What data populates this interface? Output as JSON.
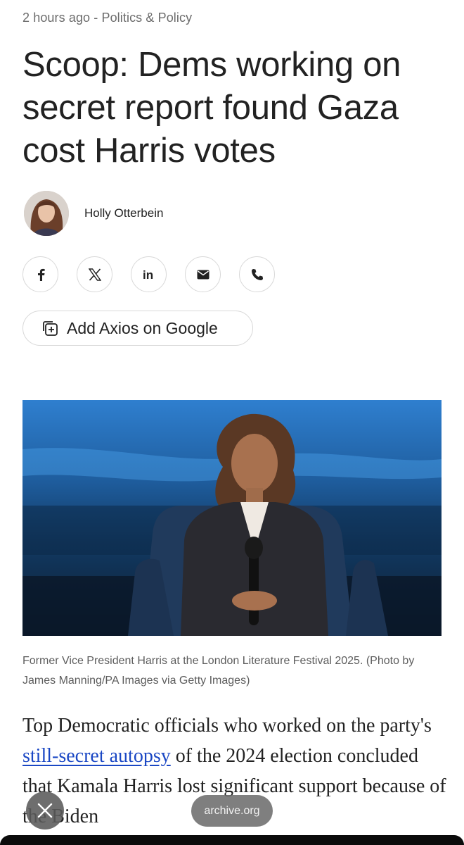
{
  "article": {
    "meta": "2 hours ago - Politics & Policy",
    "headline": "Scoop: Dems working on secret report found Gaza cost Harris votes",
    "author": "Holly Otterbein",
    "add_google_label": "Add Axios on Google",
    "share_icons": [
      "facebook-icon",
      "x-icon",
      "linkedin-icon",
      "email-icon",
      "phone-icon"
    ],
    "photo_caption": "Former Vice President Harris at the London Literature Festival 2025. (Photo by James Manning/PA Images via Getty Images)",
    "body": {
      "before_link": "Top Democratic officials who worked on the party's ",
      "link_text": "still-secret autopsy",
      "after_link": " of the 2024 election concluded that Kamala Harris lost significant support because of the Biden"
    }
  },
  "overlay": {
    "archive_label": "archive.org",
    "close_icon": "close-icon"
  },
  "colors": {
    "link": "#1a47c4",
    "meta_text": "#6b6b6b",
    "button_border": "#d8d8d8"
  }
}
